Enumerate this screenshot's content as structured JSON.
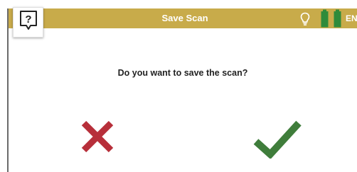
{
  "header": {
    "title": "Save Scan",
    "language": "EN",
    "help_icon": "help-question-icon",
    "light_icon": "lightbulb-icon",
    "battery_icon": "battery-icon",
    "bar_color": "#c8ab4a",
    "battery_color": "#2e8b3a"
  },
  "dialog": {
    "question": "Do you want to save the scan?",
    "cancel_icon": "x-icon",
    "confirm_icon": "checkmark-icon",
    "cancel_color": "#b72f3a",
    "confirm_color": "#3f7d3b"
  }
}
